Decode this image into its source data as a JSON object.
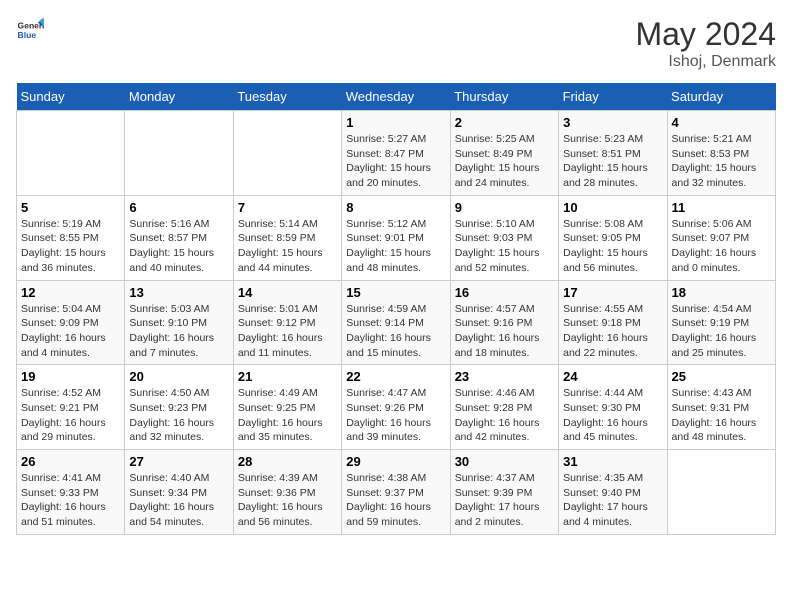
{
  "header": {
    "logo_general": "General",
    "logo_blue": "Blue",
    "month_year": "May 2024",
    "location": "Ishoj, Denmark"
  },
  "days_of_week": [
    "Sunday",
    "Monday",
    "Tuesday",
    "Wednesday",
    "Thursday",
    "Friday",
    "Saturday"
  ],
  "weeks": [
    [
      {
        "day": "",
        "content": ""
      },
      {
        "day": "",
        "content": ""
      },
      {
        "day": "",
        "content": ""
      },
      {
        "day": "1",
        "content": "Sunrise: 5:27 AM\nSunset: 8:47 PM\nDaylight: 15 hours\nand 20 minutes."
      },
      {
        "day": "2",
        "content": "Sunrise: 5:25 AM\nSunset: 8:49 PM\nDaylight: 15 hours\nand 24 minutes."
      },
      {
        "day": "3",
        "content": "Sunrise: 5:23 AM\nSunset: 8:51 PM\nDaylight: 15 hours\nand 28 minutes."
      },
      {
        "day": "4",
        "content": "Sunrise: 5:21 AM\nSunset: 8:53 PM\nDaylight: 15 hours\nand 32 minutes."
      }
    ],
    [
      {
        "day": "5",
        "content": "Sunrise: 5:19 AM\nSunset: 8:55 PM\nDaylight: 15 hours\nand 36 minutes."
      },
      {
        "day": "6",
        "content": "Sunrise: 5:16 AM\nSunset: 8:57 PM\nDaylight: 15 hours\nand 40 minutes."
      },
      {
        "day": "7",
        "content": "Sunrise: 5:14 AM\nSunset: 8:59 PM\nDaylight: 15 hours\nand 44 minutes."
      },
      {
        "day": "8",
        "content": "Sunrise: 5:12 AM\nSunset: 9:01 PM\nDaylight: 15 hours\nand 48 minutes."
      },
      {
        "day": "9",
        "content": "Sunrise: 5:10 AM\nSunset: 9:03 PM\nDaylight: 15 hours\nand 52 minutes."
      },
      {
        "day": "10",
        "content": "Sunrise: 5:08 AM\nSunset: 9:05 PM\nDaylight: 15 hours\nand 56 minutes."
      },
      {
        "day": "11",
        "content": "Sunrise: 5:06 AM\nSunset: 9:07 PM\nDaylight: 16 hours\nand 0 minutes."
      }
    ],
    [
      {
        "day": "12",
        "content": "Sunrise: 5:04 AM\nSunset: 9:09 PM\nDaylight: 16 hours\nand 4 minutes."
      },
      {
        "day": "13",
        "content": "Sunrise: 5:03 AM\nSunset: 9:10 PM\nDaylight: 16 hours\nand 7 minutes."
      },
      {
        "day": "14",
        "content": "Sunrise: 5:01 AM\nSunset: 9:12 PM\nDaylight: 16 hours\nand 11 minutes."
      },
      {
        "day": "15",
        "content": "Sunrise: 4:59 AM\nSunset: 9:14 PM\nDaylight: 16 hours\nand 15 minutes."
      },
      {
        "day": "16",
        "content": "Sunrise: 4:57 AM\nSunset: 9:16 PM\nDaylight: 16 hours\nand 18 minutes."
      },
      {
        "day": "17",
        "content": "Sunrise: 4:55 AM\nSunset: 9:18 PM\nDaylight: 16 hours\nand 22 minutes."
      },
      {
        "day": "18",
        "content": "Sunrise: 4:54 AM\nSunset: 9:19 PM\nDaylight: 16 hours\nand 25 minutes."
      }
    ],
    [
      {
        "day": "19",
        "content": "Sunrise: 4:52 AM\nSunset: 9:21 PM\nDaylight: 16 hours\nand 29 minutes."
      },
      {
        "day": "20",
        "content": "Sunrise: 4:50 AM\nSunset: 9:23 PM\nDaylight: 16 hours\nand 32 minutes."
      },
      {
        "day": "21",
        "content": "Sunrise: 4:49 AM\nSunset: 9:25 PM\nDaylight: 16 hours\nand 35 minutes."
      },
      {
        "day": "22",
        "content": "Sunrise: 4:47 AM\nSunset: 9:26 PM\nDaylight: 16 hours\nand 39 minutes."
      },
      {
        "day": "23",
        "content": "Sunrise: 4:46 AM\nSunset: 9:28 PM\nDaylight: 16 hours\nand 42 minutes."
      },
      {
        "day": "24",
        "content": "Sunrise: 4:44 AM\nSunset: 9:30 PM\nDaylight: 16 hours\nand 45 minutes."
      },
      {
        "day": "25",
        "content": "Sunrise: 4:43 AM\nSunset: 9:31 PM\nDaylight: 16 hours\nand 48 minutes."
      }
    ],
    [
      {
        "day": "26",
        "content": "Sunrise: 4:41 AM\nSunset: 9:33 PM\nDaylight: 16 hours\nand 51 minutes."
      },
      {
        "day": "27",
        "content": "Sunrise: 4:40 AM\nSunset: 9:34 PM\nDaylight: 16 hours\nand 54 minutes."
      },
      {
        "day": "28",
        "content": "Sunrise: 4:39 AM\nSunset: 9:36 PM\nDaylight: 16 hours\nand 56 minutes."
      },
      {
        "day": "29",
        "content": "Sunrise: 4:38 AM\nSunset: 9:37 PM\nDaylight: 16 hours\nand 59 minutes."
      },
      {
        "day": "30",
        "content": "Sunrise: 4:37 AM\nSunset: 9:39 PM\nDaylight: 17 hours\nand 2 minutes."
      },
      {
        "day": "31",
        "content": "Sunrise: 4:35 AM\nSunset: 9:40 PM\nDaylight: 17 hours\nand 4 minutes."
      },
      {
        "day": "",
        "content": ""
      }
    ]
  ]
}
